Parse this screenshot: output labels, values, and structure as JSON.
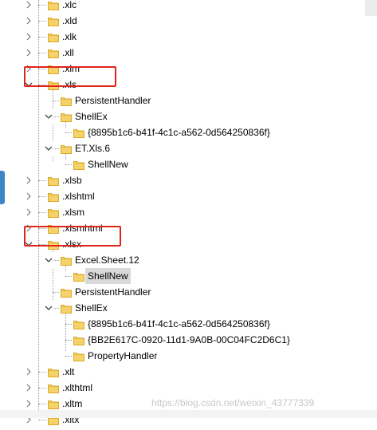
{
  "tree": {
    "items": [
      {
        "label": ".xlc",
        "level": 0,
        "expander": "collapsed"
      },
      {
        "label": ".xld",
        "level": 0,
        "expander": "collapsed"
      },
      {
        "label": ".xlk",
        "level": 0,
        "expander": "collapsed"
      },
      {
        "label": ".xll",
        "level": 0,
        "expander": "collapsed"
      },
      {
        "label": ".xlm",
        "level": 0,
        "expander": "collapsed"
      },
      {
        "label": ".xls",
        "level": 0,
        "expander": "expanded",
        "highlighted": true
      },
      {
        "label": "PersistentHandler",
        "level": 1,
        "expander": "none"
      },
      {
        "label": "ShellEx",
        "level": 1,
        "expander": "expanded"
      },
      {
        "label": "{8895b1c6-b41f-4c1c-a562-0d564250836f}",
        "level": 2,
        "expander": "none"
      },
      {
        "label": "ET.Xls.6",
        "level": 1,
        "expander": "expanded"
      },
      {
        "label": "ShellNew",
        "level": 2,
        "expander": "none"
      },
      {
        "label": ".xlsb",
        "level": 0,
        "expander": "collapsed"
      },
      {
        "label": ".xlshtml",
        "level": 0,
        "expander": "collapsed"
      },
      {
        "label": ".xlsm",
        "level": 0,
        "expander": "collapsed"
      },
      {
        "label": ".xlsmhtml",
        "level": 0,
        "expander": "collapsed"
      },
      {
        "label": ".xlsx",
        "level": 0,
        "expander": "expanded",
        "highlighted": true
      },
      {
        "label": "Excel.Sheet.12",
        "level": 1,
        "expander": "expanded"
      },
      {
        "label": "ShellNew",
        "level": 2,
        "expander": "none",
        "selected": true
      },
      {
        "label": "PersistentHandler",
        "level": 1,
        "expander": "none"
      },
      {
        "label": "ShellEx",
        "level": 1,
        "expander": "expanded"
      },
      {
        "label": "{8895b1c6-b41f-4c1c-a562-0d564250836f}",
        "level": 2,
        "expander": "none"
      },
      {
        "label": "{BB2E617C-0920-11d1-9A0B-00C04FC2D6C1}",
        "level": 2,
        "expander": "none"
      },
      {
        "label": "PropertyHandler",
        "level": 2,
        "expander": "none"
      },
      {
        "label": ".xlt",
        "level": 0,
        "expander": "collapsed"
      },
      {
        "label": ".xlthtml",
        "level": 0,
        "expander": "collapsed"
      },
      {
        "label": ".xltm",
        "level": 0,
        "expander": "collapsed"
      },
      {
        "label": ".xltx",
        "level": 0,
        "expander": "collapsed"
      }
    ]
  },
  "watermark": "https://blog.csdn.net/weixin_43777339",
  "colors": {
    "highlight_box": "#e0241b",
    "folder_fill": "#f5d36a",
    "folder_edge": "#d9a928",
    "selection": "#d9d9d9"
  },
  "icons": {
    "expanded": "chevron-down-icon",
    "collapsed": "chevron-right-icon",
    "node": "folder-icon"
  }
}
